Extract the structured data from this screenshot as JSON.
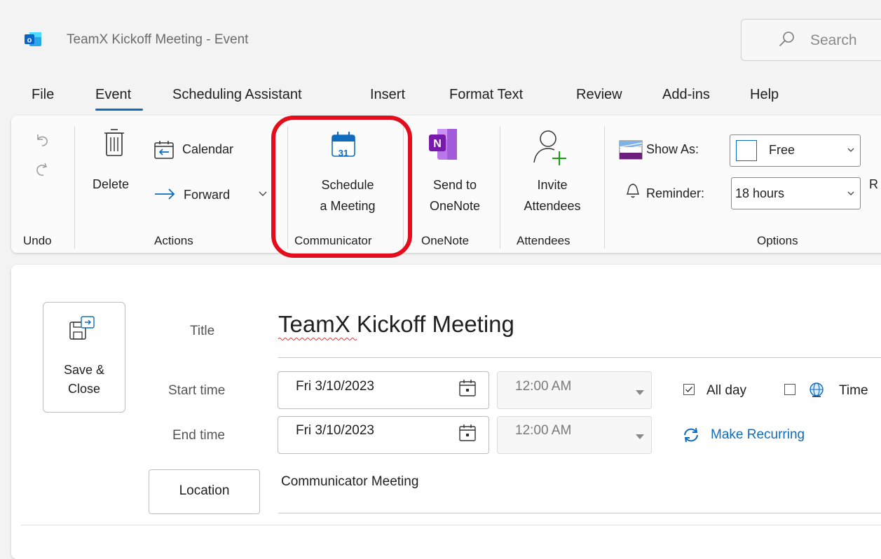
{
  "window": {
    "title": "TeamX Kickoff Meeting  -  Event",
    "search_label": "Search"
  },
  "menu": {
    "tabs": [
      "File",
      "Event",
      "Scheduling Assistant",
      "Insert",
      "Format Text",
      "Review",
      "Add-ins",
      "Help"
    ],
    "active_tab": "Event"
  },
  "ribbon": {
    "groups": {
      "undo": "Undo",
      "actions": "Actions",
      "communicator": "Communicator",
      "onenote": "OneNote",
      "attendees": "Attendees",
      "options": "Options"
    },
    "delete_label": "Delete",
    "calendar_label": "Calendar",
    "forward_label": "Forward",
    "schedule_line1": "Schedule",
    "schedule_line2": "a Meeting",
    "calendar_day": "31",
    "onenote_line1": "Send to",
    "onenote_line2": "OneNote",
    "invite_line1": "Invite",
    "invite_line2": "Attendees",
    "show_as_label": "Show As:",
    "show_as_value": "Free",
    "reminder_label": "Reminder:",
    "reminder_value": "18 hours",
    "cut_label": "R"
  },
  "form": {
    "save_line1": "Save &",
    "save_line2": "Close",
    "title_label": "Title",
    "title_value": "TeamX Kickoff Meeting",
    "start_label": "Start time",
    "start_date": "Fri 3/10/2023",
    "start_time": "12:00 AM",
    "end_label": "End time",
    "end_date": "Fri 3/10/2023",
    "end_time": "12:00 AM",
    "all_day_label": "All day",
    "all_day_checked": true,
    "time_zones_label": "Time",
    "make_recurring_label": "Make Recurring",
    "location_button_label": "Location",
    "location_value": "Communicator Meeting"
  },
  "colors": {
    "accent": "#0f6cbd",
    "highlight": "#e30d1c",
    "onenote": "#7719aa",
    "outlook": "#0a64c8"
  }
}
